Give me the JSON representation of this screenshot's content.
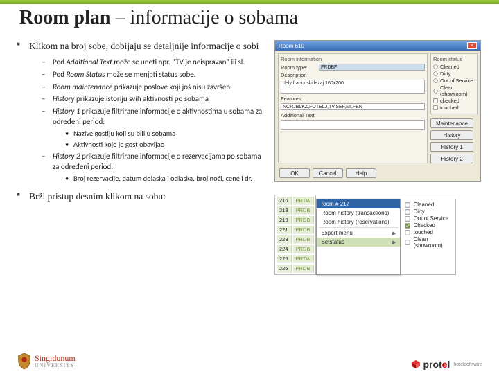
{
  "title_bold": "Room plan",
  "title_rest": " – informacije o sobama",
  "bullet1": "Klikom na broj sobe, dobijaju se detaljnije informacije o sobi",
  "sub": {
    "s1a": "Pod ",
    "s1i": "Additional Text",
    "s1b": " može se uneti npr. “TV je neispravan” ili sl.",
    "s2a": "Pod ",
    "s2i": "Room Status",
    "s2b": " može se menjati status sobe.",
    "s3i": "Room maintenance",
    "s3b": " prikazuje poslove koji još nisu završeni",
    "s4i": "History ",
    "s4b": " prikazuje istoriju svih aktivnosti po sobama",
    "s5i": "History 1",
    "s5b": " prikazuje filtrirane informacije o aktivnostima u sobama za određeni period:",
    "s5_1": "Nazive gostiju koji su bili u sobama",
    "s5_2": "Aktivnosti koje je gost obavljao",
    "s6i": "History 2",
    "s6b": " prikazuje filtrirane informacije o rezervacijama po sobama za određeni period:",
    "s6_1": "Broj rezervacije, datum dolaska i odlaska, broj noći, cene i dr."
  },
  "bullet2": "Brži pristup desnim klikom na sobu:",
  "dialog": {
    "title": "Room  610",
    "grp_info": "Room information",
    "lbl_type": "Room type:",
    "val_type": "FRDBF",
    "lbl_desc": "Description",
    "val_desc": "dely francuski lezaj 160x200",
    "lbl_feat": "Features:",
    "val_feat": "NCRJBLKZ,FOTELJ,TV,SEF,MI,FEN",
    "lbl_add": "Additional Text",
    "grp_status": "Room status",
    "st1": "Cleaned",
    "st2": "Dirty",
    "st3": "Out of Service",
    "st4": "Clean (showroom)",
    "ck1": "checked",
    "ck2": "touched",
    "btn_maint": "Maintenance",
    "btn_hist": "History",
    "btn_h1": "History 1",
    "btn_h2": "History 2",
    "ok": "OK",
    "cancel": "Cancel",
    "help": "Help"
  },
  "ctx": {
    "rows": [
      [
        "216",
        "PRTW"
      ],
      [
        "218",
        "PRDB"
      ],
      [
        "219",
        "PRDB"
      ],
      [
        "221",
        "PRDB"
      ],
      [
        "223",
        "PRDB"
      ],
      [
        "224",
        "PRDB"
      ],
      [
        "225",
        "PRTW"
      ],
      [
        "226",
        "PRDB"
      ]
    ],
    "menu_title": "room # 217",
    "m1": "Room history (transactions)",
    "m2": "Room history (reservations)",
    "m3": "Export menu",
    "m4": "Setstatus",
    "statuses": [
      "Cleaned",
      "Dirty",
      "Out of Service",
      "Checked",
      "touched",
      "Clean (showroom)"
    ]
  },
  "brand_left": "Singidunum",
  "brand_left_sub": "UNIVERSITY",
  "brand_right_a": "prot",
  "brand_right_b": "e",
  "brand_right_c": "l",
  "brand_right_tag": "hotelsoftware"
}
